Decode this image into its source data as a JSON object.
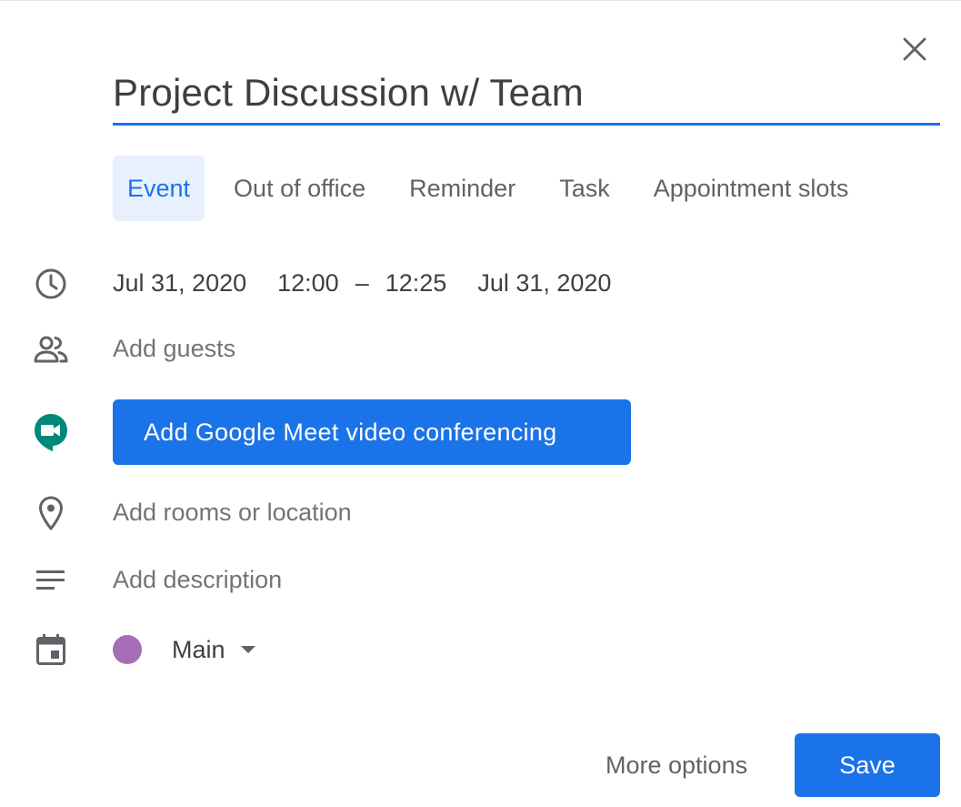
{
  "event": {
    "title": "Project Discussion w/ Team"
  },
  "tabs": [
    {
      "label": "Event",
      "active": true
    },
    {
      "label": "Out of office",
      "active": false
    },
    {
      "label": "Reminder",
      "active": false
    },
    {
      "label": "Task",
      "active": false
    },
    {
      "label": "Appointment slots",
      "active": false
    }
  ],
  "datetime": {
    "start_date": "Jul 31, 2020",
    "start_time": "12:00",
    "separator": "–",
    "end_time": "12:25",
    "end_date": "Jul 31, 2020"
  },
  "guests": {
    "placeholder": "Add guests"
  },
  "meet": {
    "button_label": "Add Google Meet video conferencing"
  },
  "location": {
    "placeholder": "Add rooms or location"
  },
  "description": {
    "placeholder": "Add description"
  },
  "calendar": {
    "name": "Main",
    "color": "#a56eb7"
  },
  "footer": {
    "more_options": "More options",
    "save": "Save"
  },
  "colors": {
    "accent": "#1a73e8",
    "accent_light": "#e8f0fe",
    "text_primary": "#3c4043",
    "text_secondary": "#5f6368"
  },
  "icons": {
    "close": "close-icon",
    "time": "clock-icon",
    "guests": "people-icon",
    "meet": "google-meet-icon",
    "location": "location-pin-icon",
    "description": "notes-lines-icon",
    "calendar": "calendar-icon",
    "dropdown": "dropdown-arrow-icon"
  }
}
